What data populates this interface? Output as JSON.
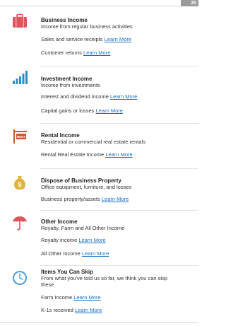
{
  "page_badge": "20",
  "learn_more": "Learn More",
  "sections": [
    {
      "title": "Business Income",
      "subtitle": "Income from regular business activities",
      "icon": "briefcase-icon",
      "items": [
        "Sales and service receipts",
        "Customer returns"
      ]
    },
    {
      "title": "Investment Income",
      "subtitle": "Income from investments",
      "icon": "bar-chart-icon",
      "items": [
        "Interest and dividend income",
        "Capital gains or losses"
      ]
    },
    {
      "title": "Rental Income",
      "subtitle": "Residential or commercial real estate rentals",
      "icon": "rent-sign-icon",
      "icon_text": "RENT",
      "items": [
        "Rental Real Estate Income"
      ]
    },
    {
      "title": "Dispose of Business Property",
      "subtitle": "Office equipment, furniture, and losses",
      "icon": "money-bag-icon",
      "icon_text": "$",
      "items": [
        "Business property/assets"
      ]
    },
    {
      "title": "Other Income",
      "subtitle": "Royalty, Farm and All Other Income",
      "icon": "umbrella-icon",
      "items": [
        "Royalty income",
        "All Other Income"
      ]
    },
    {
      "title": "Items You Can Skip",
      "subtitle_line1": "From what you've told us so far, we think you can skip",
      "subtitle_line2": "these",
      "icon": "clock-icon",
      "items": [
        "Farm Income",
        "K-1s received"
      ]
    }
  ],
  "colors": {
    "link": "#1a6fc1",
    "briefcase": "#e0545d",
    "chart": "#2a8fc7",
    "rent": "#c9582c",
    "moneybag": "#e0b43a",
    "umbrella": "#e0545d",
    "clock": "#4b9be0"
  }
}
